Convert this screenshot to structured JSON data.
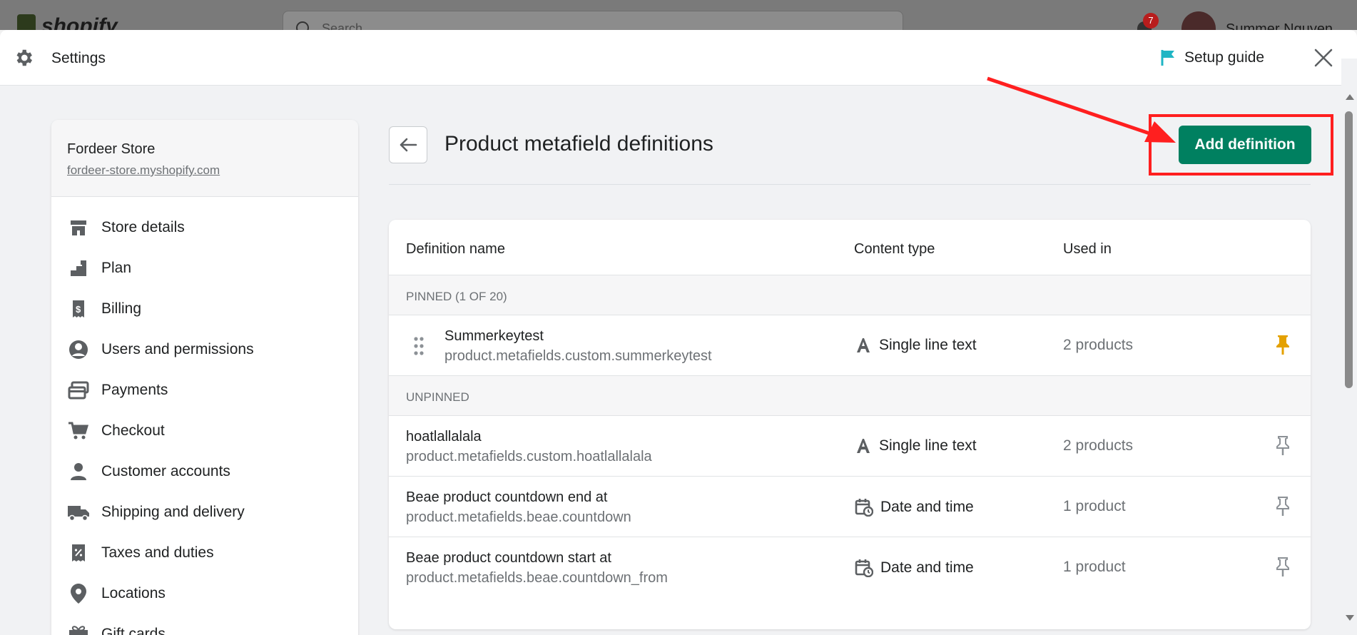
{
  "topbar": {
    "logo_text": "shopify",
    "search_placeholder": "Search",
    "notification_count": "7",
    "user_name": "Summer Nguyen"
  },
  "header": {
    "title": "Settings",
    "setup_guide_label": "Setup guide"
  },
  "store": {
    "name": "Fordeer Store",
    "url": "fordeer-store.myshopify.com"
  },
  "nav": {
    "items": [
      {
        "label": "Store details",
        "icon": "store-icon"
      },
      {
        "label": "Plan",
        "icon": "plan-icon"
      },
      {
        "label": "Billing",
        "icon": "billing-icon"
      },
      {
        "label": "Users and permissions",
        "icon": "user-circle-icon"
      },
      {
        "label": "Payments",
        "icon": "payments-icon"
      },
      {
        "label": "Checkout",
        "icon": "cart-icon"
      },
      {
        "label": "Customer accounts",
        "icon": "person-icon"
      },
      {
        "label": "Shipping and delivery",
        "icon": "truck-icon"
      },
      {
        "label": "Taxes and duties",
        "icon": "tax-icon"
      },
      {
        "label": "Locations",
        "icon": "location-pin-icon"
      },
      {
        "label": "Gift cards",
        "icon": "gift-icon"
      }
    ]
  },
  "page": {
    "title": "Product metafield definitions",
    "add_button_label": "Add definition"
  },
  "table": {
    "headers": {
      "name": "Definition name",
      "content_type": "Content type",
      "used_in": "Used in"
    },
    "pinned_label": "PINNED (1 OF 20)",
    "unpinned_label": "UNPINNED",
    "pinned_rows": [
      {
        "name": "Summerkeytest",
        "key": "product.metafields.custom.summerkeytest",
        "content_type": "Single line text",
        "used_in": "2 products",
        "pinned": true
      }
    ],
    "unpinned_rows": [
      {
        "name": "hoatlallalala",
        "key": "product.metafields.custom.hoatlallalala",
        "content_type": "Single line text",
        "used_in": "2 products",
        "pinned": false
      },
      {
        "name": "Beae product countdown end at",
        "key": "product.metafields.beae.countdown",
        "content_type": "Date and time",
        "used_in": "1 product",
        "pinned": false
      },
      {
        "name": "Beae product countdown start at",
        "key": "product.metafields.beae.countdown_from",
        "content_type": "Date and time",
        "used_in": "1 product",
        "pinned": false
      }
    ]
  },
  "colors": {
    "primary_button": "#008060",
    "pin_active": "#e4a100",
    "annotation": "#ff1f1f",
    "setup_flag": "#1fb5c4"
  }
}
